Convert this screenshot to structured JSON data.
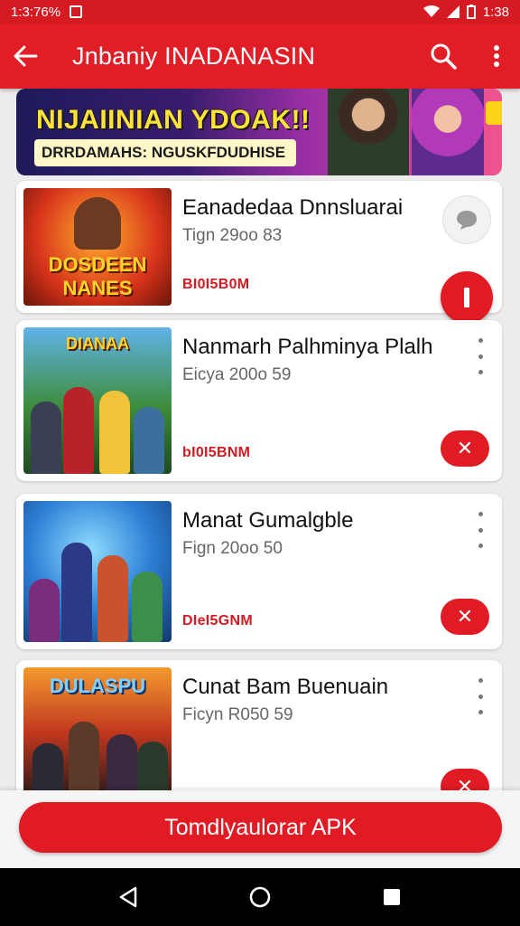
{
  "status_bar": {
    "left_text": "1:3:76%",
    "right_text": "1:38"
  },
  "app_bar": {
    "title": "Jnbaniy INADANASIN",
    "back_icon": "arrow-left-icon",
    "search_icon": "search-icon",
    "menu_icon": "more-vertical-icon"
  },
  "banner": {
    "headline": "NIJAIINIAN YDOAK!!",
    "subline": "DRRDAMAHS: NGUSKFDUDHISE"
  },
  "downloads": [
    {
      "name": "Eanadedaa Dnnsluarai",
      "date": "Tign 29oo 83",
      "size": "BI0I5B0M",
      "action": "pause"
    },
    {
      "name": "Nanmarh Palhminya Plalh",
      "date": "Eicya 200o 59",
      "size": "bI0I5BNM",
      "action": "cancel"
    },
    {
      "name": "Manat Gumalgble",
      "date": "Fign 20oo 50",
      "size": "DIeI5GNM",
      "action": "cancel"
    },
    {
      "name": "Cunat Bam Buenuain",
      "date": "Ficyn R050 59",
      "size": "",
      "action": "cancel"
    }
  ],
  "thumb_logos": [
    "DOSDEEN NANES",
    "DIANAA",
    "",
    "DULASPU"
  ],
  "bottom_button": {
    "label": "Tomdlyaulorar APK"
  },
  "colors": {
    "primary": "#e11d26",
    "status": "#d61a22"
  }
}
